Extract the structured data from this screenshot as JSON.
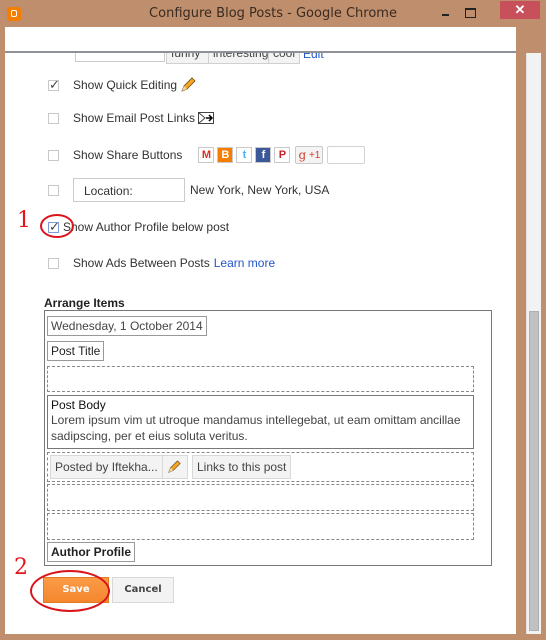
{
  "window": {
    "title": "Configure Blog Posts - Google Chrome",
    "icon": "blogger-icon",
    "controls": {
      "minimize": "minimize-icon",
      "maximize": "maximize-icon",
      "close": "✕"
    }
  },
  "partial_row": {
    "tags": [
      "funny",
      "interesting",
      "cool"
    ],
    "edit_link": "Edit"
  },
  "options": [
    {
      "label": "Show Quick Editing",
      "checked": true,
      "icon": "pencil-icon"
    },
    {
      "label": "Show Email Post Links",
      "checked": false,
      "icon": "email-post-icon"
    },
    {
      "label": "Show Share Buttons",
      "checked": false,
      "share_icons": [
        "gmail-icon",
        "blogger-icon",
        "twitter-icon",
        "facebook-icon",
        "pinterest-icon"
      ],
      "gplus_label": "+1"
    },
    {
      "label": "Location:",
      "checked": false,
      "value": "New York, New York, USA"
    },
    {
      "label": "Show Author Profile below post",
      "checked": true
    },
    {
      "label": "Show Ads Between Posts",
      "checked": false,
      "link": "Learn more"
    }
  ],
  "arrange": {
    "title": "Arrange Items",
    "date": "Wednesday, 1 October 2014",
    "post_title": "Post Title",
    "post_body_title": "Post Body",
    "post_body_text": "Lorem ipsum vim ut utroque mandamus intellegebat, ut eam omittam ancillae sadipscing, per et eius soluta veritus.",
    "posted_by": "Posted by Iftekha...",
    "links": "Links to this post",
    "author_profile": "Author Profile"
  },
  "buttons": {
    "save": "Save",
    "cancel": "Cancel"
  },
  "annotations": {
    "one": "1",
    "two": "2",
    "color": "#e4151b"
  }
}
